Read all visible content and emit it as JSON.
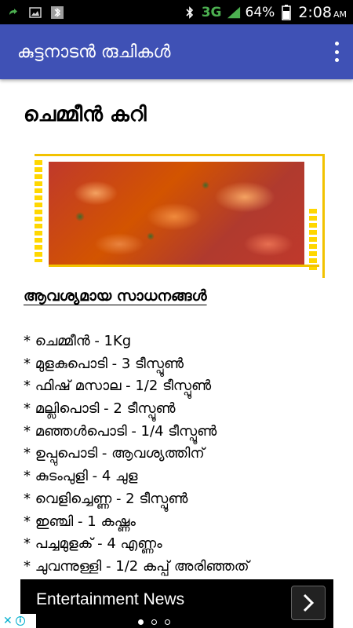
{
  "status_bar": {
    "network": "3G",
    "battery": "64%",
    "time": "2:08",
    "ampm": "AM"
  },
  "app_bar": {
    "title": "കുട്ടനാടൻ രുചികൾ"
  },
  "recipe": {
    "title": "ചെമ്മീൻ കറി",
    "ingredients_heading": "ആവശ്യമായ സാധനങ്ങൾ",
    "ingredients": [
      "* ചെമ്മീൻ - 1Kg",
      "* മുളകുപൊടി - 3 ടീസ്പൂൺ",
      "* ഫിഷ് മസാല - 1/2 ടീസ്പൂൺ",
      "* മല്ലിപൊടി - 2 ടീസ്പൂൺ",
      "* മഞ്ഞൾപൊടി - 1/4 ടീസ്പൂൺ",
      "* ഉപ്പുപൊടി - ആവശ്യത്തിന്",
      "* കുടംപുളി - 4 ചുള",
      "* വെളിച്ചെണ്ണ - 2 ടീസ്പൂൺ",
      "* ഇഞ്ചി - 1 കഷ്ണം",
      "* പച്ചമുളക് - 4 എണ്ണം",
      "* ചുവന്നുള്ളി - 1/2 കപ്പ് അരിഞ്ഞത്"
    ]
  },
  "ad": {
    "text": "Entertainment News"
  },
  "colors": {
    "app_bar": "#3f51b5",
    "accent_frame": "#f2c200"
  }
}
